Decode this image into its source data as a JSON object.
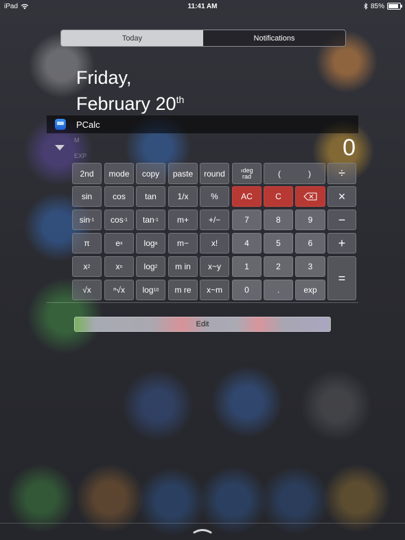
{
  "status": {
    "device": "iPad",
    "time": "11:41 AM",
    "battery": "85%",
    "battery_level": 0.85
  },
  "tabs": {
    "today": "Today",
    "notifications": "Notifications"
  },
  "date": {
    "line1": "Friday,",
    "line2": "February 20",
    "suffix": "th"
  },
  "widget": {
    "app_name": "PCalc",
    "display_value": "0",
    "faint1": "M",
    "faint2": "EXP"
  },
  "keys": {
    "row1": [
      "2nd",
      "mode",
      "copy",
      "paste",
      "round"
    ],
    "deg": "deg",
    "rad": "rad",
    "paren_open": "(",
    "paren_close": ")",
    "divide": "÷",
    "row2": [
      "sin",
      "cos",
      "tan",
      "1/x",
      "%"
    ],
    "ac": "AC",
    "c": "C",
    "multiply": "×",
    "sin_inv_base": "sin",
    "cos_inv_base": "cos",
    "tan_inv_base": "tan",
    "inv_exp": "-1",
    "mplus": "m+",
    "plusminus": "+/−",
    "n7": "7",
    "n8": "8",
    "n9": "9",
    "minus": "−",
    "pi": "π",
    "e_base": "e",
    "e_exp": "x",
    "log_base": "log",
    "log_sub": "a",
    "mminus": "m−",
    "xfact": "x!",
    "n4": "4",
    "n5": "5",
    "n6": "6",
    "plus": "+",
    "x2_base": "x",
    "x2_exp": "2",
    "xn_base": "x",
    "xn_exp": "n",
    "log2_base": "log",
    "log2_sub": "2",
    "min": "m in",
    "xy_swap": "x~y",
    "n1": "1",
    "n2": "2",
    "n3": "3",
    "equals": "=",
    "sqrt": "√x",
    "nroot": "ⁿ√x",
    "log10_base": "log",
    "log10_sub": "10",
    "mre": "m re",
    "xm_swap": "x~m",
    "n0": "0",
    "dot": ".",
    "exp": "exp"
  },
  "edit_label": "Edit",
  "colors": {
    "red_key": "#b63934",
    "tab_active_bg": "#cfd0d3"
  }
}
